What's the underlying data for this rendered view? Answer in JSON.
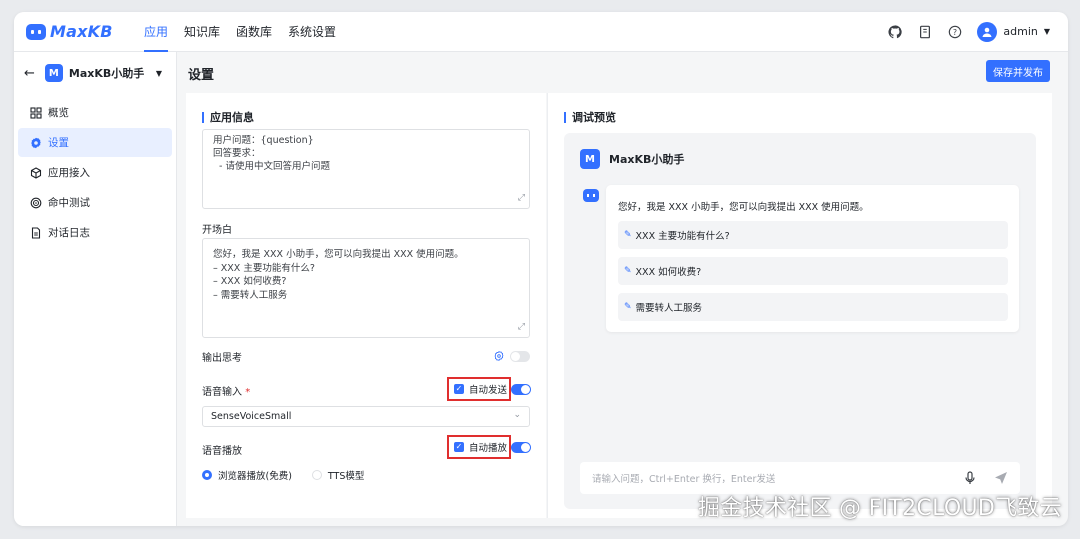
{
  "brand": {
    "name": "MaxKB"
  },
  "nav": [
    {
      "label": "应用",
      "active": true
    },
    {
      "label": "知识库",
      "active": false
    },
    {
      "label": "函数库",
      "active": false
    },
    {
      "label": "系统设置",
      "active": false
    }
  ],
  "header": {
    "user": "admin",
    "icons": [
      "github-icon",
      "docs-icon",
      "help-icon"
    ]
  },
  "sidebar": {
    "app_badge": "M",
    "app_name": "MaxKB小助手",
    "items": [
      {
        "label": "概览",
        "icon": "grid-icon",
        "active": false
      },
      {
        "label": "设置",
        "icon": "gear-icon",
        "active": true
      },
      {
        "label": "应用接入",
        "icon": "cube-icon",
        "active": false
      },
      {
        "label": "命中测试",
        "icon": "target-icon",
        "active": false
      },
      {
        "label": "对话日志",
        "icon": "document-icon",
        "active": false
      }
    ]
  },
  "page": {
    "title": "设置",
    "save_button": "保存并发布"
  },
  "app_info": {
    "section_title": "应用信息",
    "prompt_lines": [
      "用户问题：{question}",
      "回答要求：",
      "  - 请使用中文回答用户问题"
    ],
    "opening_label": "开场白",
    "opening_lines": [
      "您好，我是 XXX 小助手，您可以向我提出 XXX 使用问题。",
      "– XXX 主要功能有什么?",
      "– XXX 如何收费?",
      "– 需要转人工服务"
    ],
    "output_thinking_label": "输出思考",
    "output_thinking_enabled": false,
    "voice_input_label": "语音输入",
    "required_mark": "*",
    "auto_send_label": "自动发送",
    "auto_send_checked": true,
    "voice_input_enabled": true,
    "voice_model": "SenseVoiceSmall",
    "voice_play_label": "语音播放",
    "auto_play_label": "自动播放",
    "auto_play_checked": true,
    "voice_play_enabled": true,
    "play_options": [
      {
        "label": "浏览器播放(免费)",
        "selected": true
      },
      {
        "label": "TTS模型",
        "selected": false
      }
    ]
  },
  "preview": {
    "section_title": "调试预览",
    "badge": "M",
    "app_name": "MaxKB小助手",
    "greeting": "您好，我是 XXX 小助手，您可以向我提出 XXX 使用问题。",
    "suggestions": [
      "XXX 主要功能有什么?",
      "XXX 如何收费?",
      "需要转人工服务"
    ],
    "input_placeholder": "请输入问题，Ctrl+Enter 换行，Enter发送"
  },
  "watermark": "掘金技术社区 @ FIT2CLOUD飞致云"
}
